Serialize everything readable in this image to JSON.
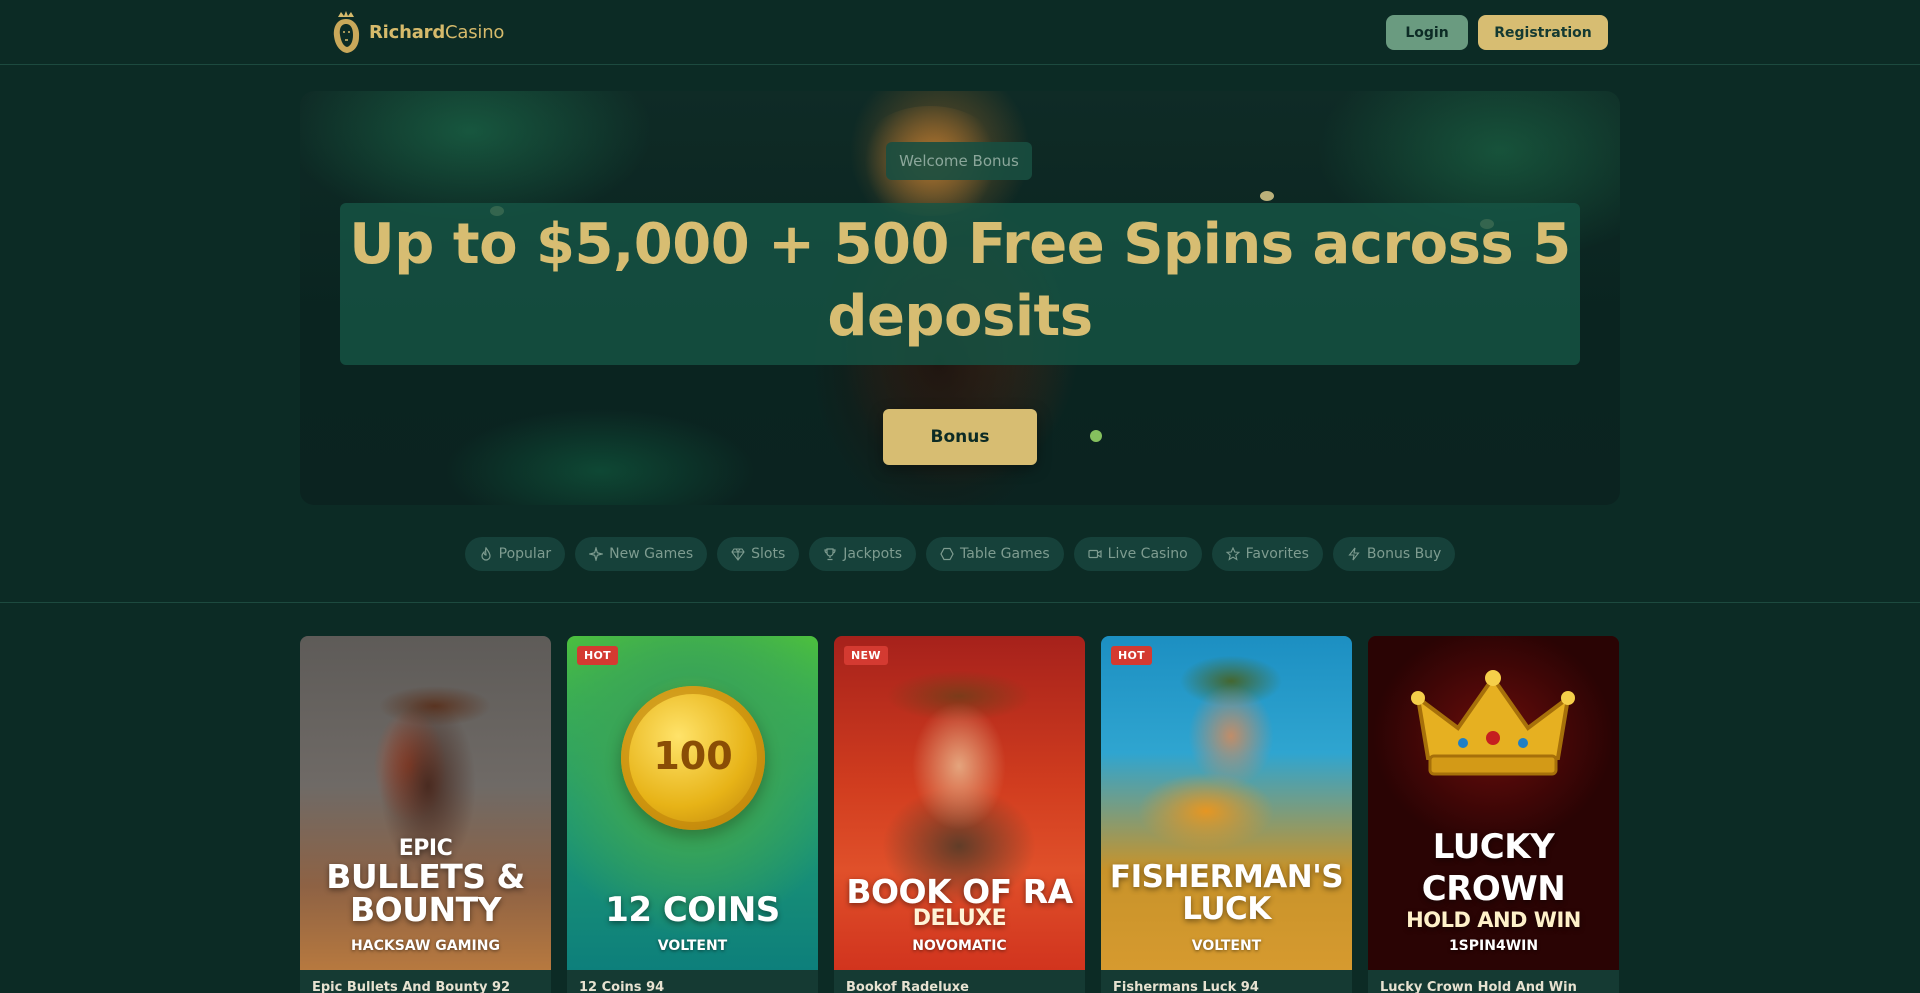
{
  "header": {
    "brand_bold": "Richard",
    "brand_light": "Casino",
    "login_label": "Login",
    "register_label": "Registration"
  },
  "hero": {
    "eyebrow": "Welcome Bonus",
    "title_line1": "Up to $5,000 + 500 Free Spins across 5",
    "title_line2": "deposits",
    "cta_label": "Bonus"
  },
  "categories": [
    {
      "label": "Popular",
      "icon": "flame-icon"
    },
    {
      "label": "New Games",
      "icon": "sparkle-icon"
    },
    {
      "label": "Slots",
      "icon": "diamond-icon"
    },
    {
      "label": "Jackpots",
      "icon": "trophy-icon"
    },
    {
      "label": "Table Games",
      "icon": "hexagon-icon"
    },
    {
      "label": "Live Casino",
      "icon": "video-icon"
    },
    {
      "label": "Favorites",
      "icon": "star-icon"
    },
    {
      "label": "Bonus Buy",
      "icon": "bolt-icon"
    }
  ],
  "games": [
    {
      "badge": "",
      "art_pre": "EPIC",
      "art_title_1": "BULLETS &",
      "art_title_2": "BOUNTY",
      "art_sub": "",
      "provider": "HACKSAW GAMING",
      "caption": "Epic Bullets And Bounty 92"
    },
    {
      "badge": "HOT",
      "art_pre": "",
      "art_title_1": "12 COINS",
      "art_title_2": "",
      "art_sub": "",
      "provider": "VOLTENT",
      "caption": "12 Coins 94",
      "coin_text": "100"
    },
    {
      "badge": "NEW",
      "art_pre": "",
      "art_title_1": "BOOK OF RA",
      "art_title_2": "",
      "art_sub": "DELUXE",
      "provider": "NOVOMATIC",
      "caption": "Bookof Radeluxe"
    },
    {
      "badge": "HOT",
      "art_pre": "",
      "art_title_1": "FISHERMAN'S",
      "art_title_2": "LUCK",
      "art_sub": "",
      "provider": "VOLTENT",
      "caption": "Fishermans Luck 94"
    },
    {
      "badge": "",
      "art_pre": "",
      "art_title_1": "LUCKY",
      "art_title_2": "CROWN",
      "art_sub": "HOLD AND WIN",
      "provider": "1SPIN4WIN",
      "caption": "Lucky Crown Hold And Win"
    }
  ],
  "colors": {
    "background": "#0c2b25",
    "gold": "#d7bd72",
    "login_green": "#6a9b80",
    "badge_red": "#d43a31"
  }
}
